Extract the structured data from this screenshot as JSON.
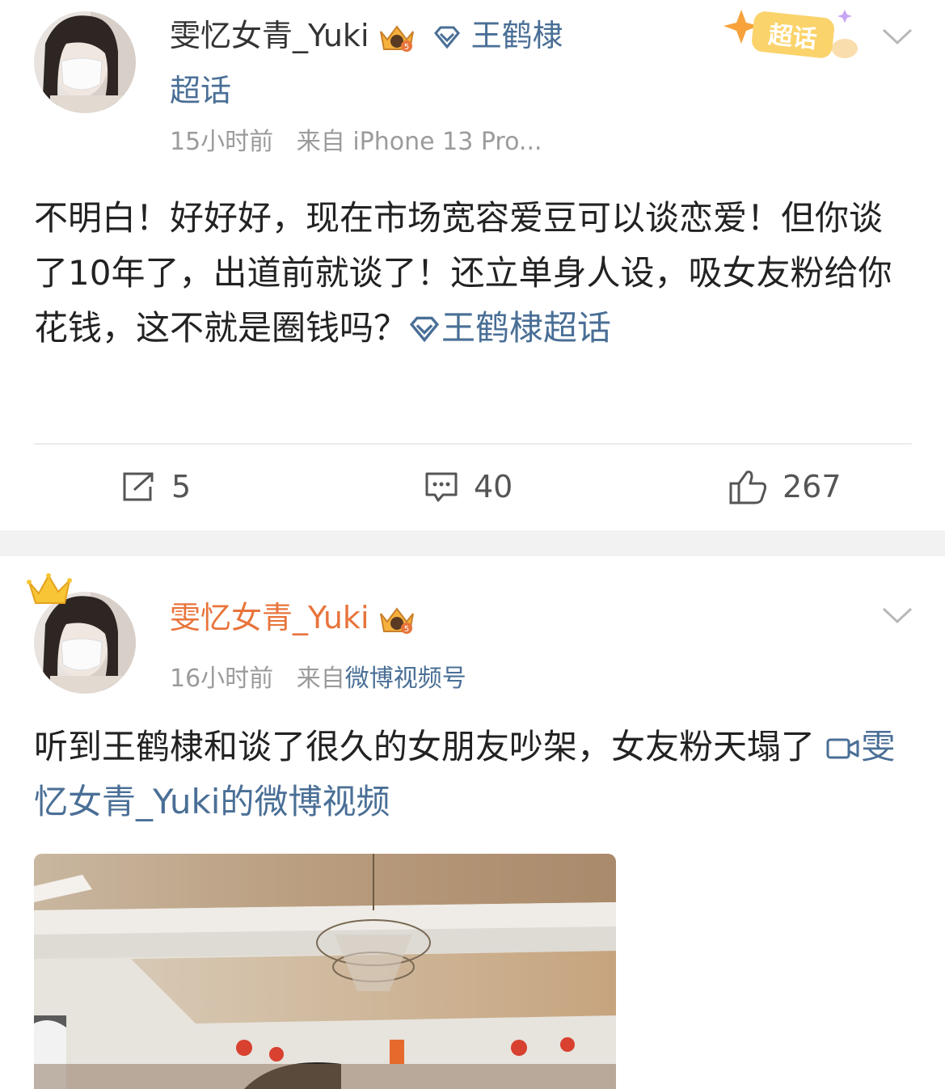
{
  "post1": {
    "username": "雯忆女青_Yuki",
    "topic_name_line1": "王鹤棣",
    "topic_name_line2": "超话",
    "time": "15小时前",
    "source": "来自 iPhone 13 Pro...",
    "supertopic_badge": "超话",
    "content": "不明白！好好好，现在市场宽容爱豆可以谈恋爱！但你谈了10年了，出道前就谈了！还立单身人设，吸女友粉给你花钱，这不就是圈钱吗？",
    "content_topic_link": "王鹤棣超话",
    "actions": {
      "repost_count": "5",
      "comment_count": "40",
      "like_count": "267"
    }
  },
  "post2": {
    "username": "雯忆女青_Yuki",
    "time": "16小时前",
    "source_prefix": "来自",
    "source_link": "微博视频号",
    "content": "听到王鹤棣和谈了很久的女朋友吵架，女友粉天塌了",
    "video_link": "雯忆女青_Yuki的微博视频"
  },
  "colors": {
    "link": "#4a6f96",
    "vip_name": "#e8743b",
    "meta": "#9b9b9b",
    "text": "#222222"
  },
  "icons": [
    "crown-icon",
    "vip-level-badge-icon",
    "diamond-icon",
    "chevron-down-icon",
    "repost-icon",
    "comment-icon",
    "like-icon",
    "video-icon"
  ]
}
